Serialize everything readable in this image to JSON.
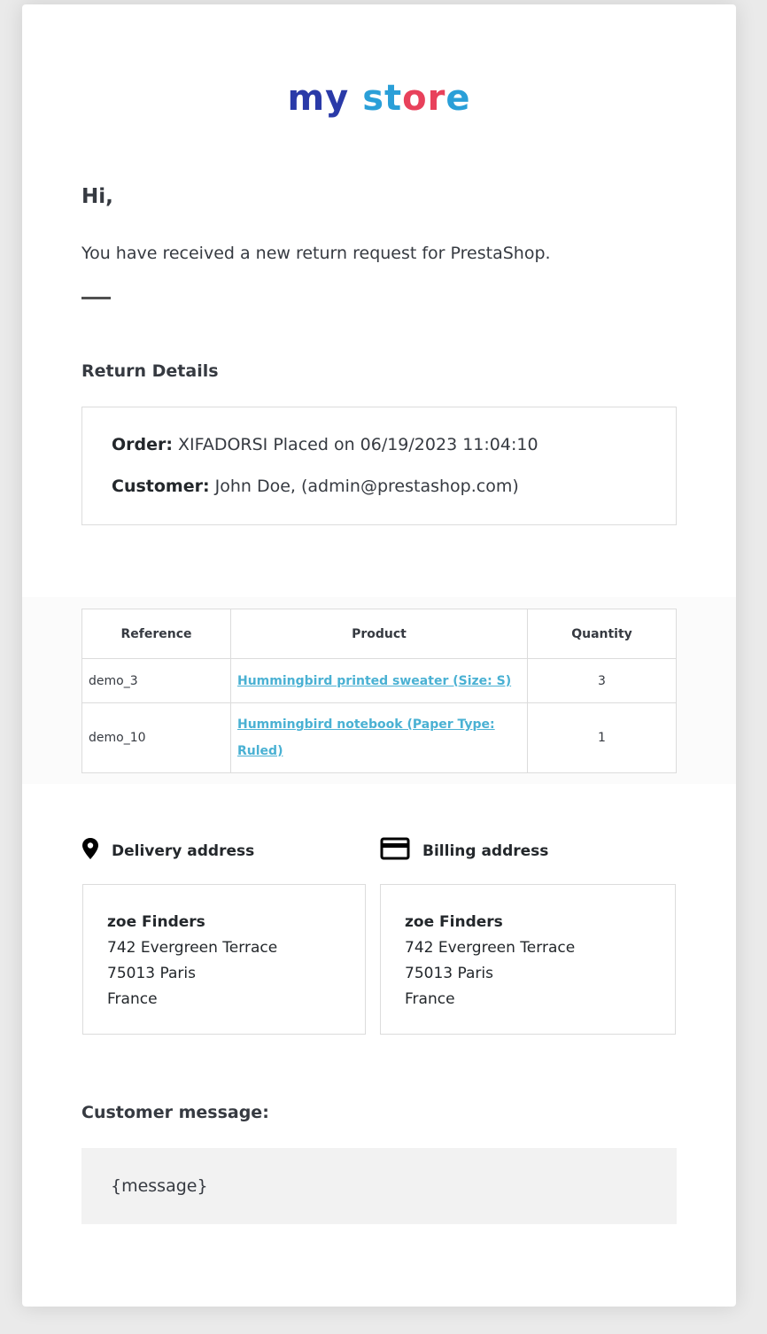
{
  "logo": {
    "part1": "my",
    "part2": "st",
    "part3": "or",
    "part4": "e"
  },
  "greeting": "Hi,",
  "intro": "You have received a new return request for PrestaShop.",
  "return_details": {
    "title": "Return Details",
    "order_label": "Order:",
    "order_value": "XIFADORSI Placed on 06/19/2023 11:04:10",
    "customer_label": "Customer:",
    "customer_value": "John Doe, (admin@prestashop.com)"
  },
  "products_table": {
    "headers": [
      "Reference",
      "Product",
      "Quantity"
    ],
    "rows": [
      {
        "reference": "demo_3",
        "product": "Hummingbird printed sweater (Size: S)",
        "quantity": "3"
      },
      {
        "reference": "demo_10",
        "product": "Hummingbird notebook (Paper Type: Ruled)",
        "quantity": "1"
      }
    ]
  },
  "delivery": {
    "title": "Delivery address",
    "icon": "map-pin-icon",
    "name": "zoe Finders",
    "street": "742 Evergreen Terrace",
    "city": "75013 Paris",
    "country": "France"
  },
  "billing": {
    "title": "Billing address",
    "icon": "credit-card-icon",
    "name": "zoe Finders",
    "street": "742 Evergreen Terrace",
    "city": "75013 Paris",
    "country": "France"
  },
  "customer_message": {
    "title": "Customer message:",
    "value": "{message}"
  },
  "colors": {
    "background": "#eaeaea",
    "card": "#ffffff",
    "link": "#4ab1d3",
    "text": "#363a41",
    "message_bg": "#f2f2f2"
  }
}
